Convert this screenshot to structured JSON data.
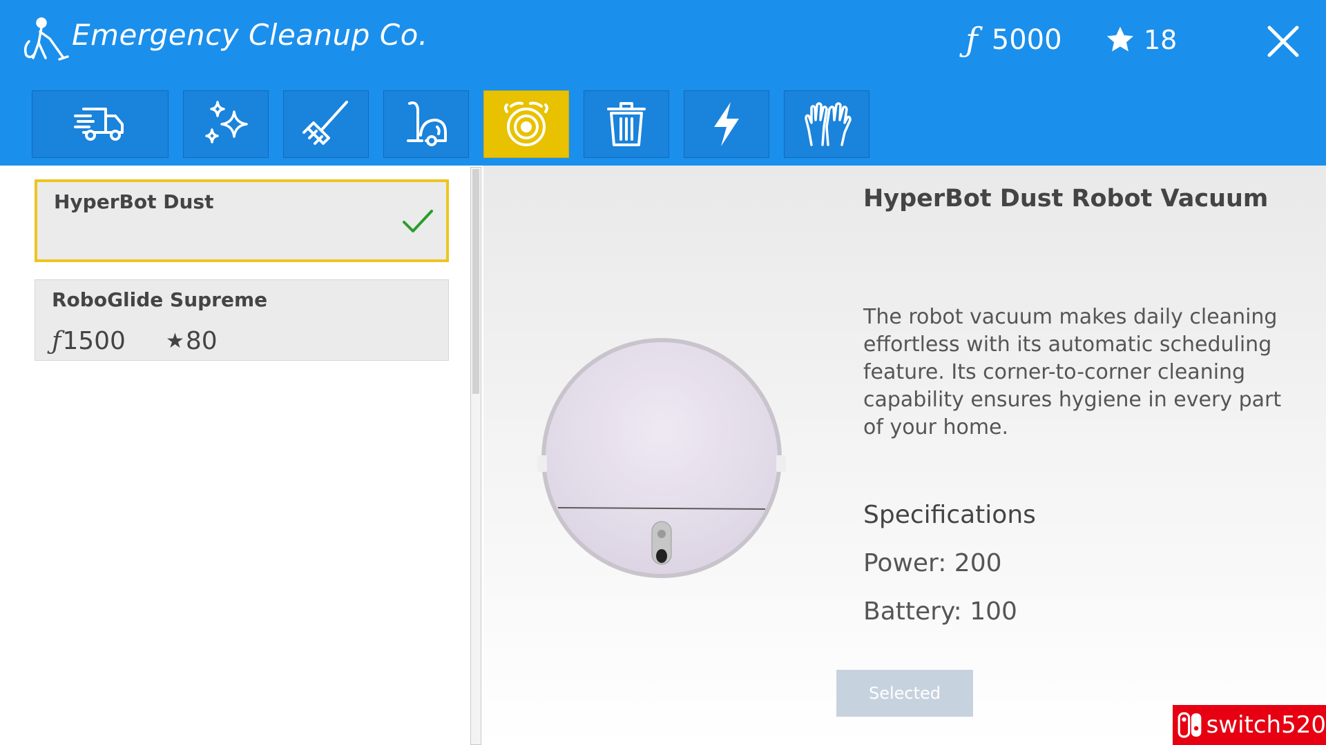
{
  "header": {
    "title": "Emergency Cleanup Co.",
    "logo_icon": "janitor-vacuum-icon",
    "currency_symbol": "ƒ",
    "money": "5000",
    "stars": "18",
    "close_icon": "close-icon"
  },
  "tabs": [
    {
      "icon": "cleaning-van-icon",
      "active": false
    },
    {
      "icon": "sparkles-icon",
      "active": false
    },
    {
      "icon": "mop-icon",
      "active": false
    },
    {
      "icon": "vacuum-cleaner-icon",
      "active": false
    },
    {
      "icon": "robot-vacuum-icon",
      "active": true
    },
    {
      "icon": "trash-can-icon",
      "active": false
    },
    {
      "icon": "lightning-icon",
      "active": false
    },
    {
      "icon": "gloves-icon",
      "active": false
    }
  ],
  "items": [
    {
      "name": "HyperBot Dust",
      "selected": true
    },
    {
      "name": "RoboGlide Supreme",
      "currency_symbol": "ƒ",
      "price": "1500",
      "star_symbol": "★",
      "stars": "80",
      "selected": false
    }
  ],
  "detail": {
    "title": "HyperBot Dust Robot Vacuum",
    "description": "The robot vacuum makes daily cleaning effortless with its automatic scheduling feature. Its corner-to-corner cleaning capability ensures hygiene in every part of your home.",
    "spec_title": "Specifications",
    "power": "Power: 200",
    "battery": "Battery: 100",
    "button": "Selected"
  },
  "watermark": "switch520",
  "colors": {
    "header": "#1b8fec",
    "tab": "#1a83dc",
    "tab_active": "#e8c100",
    "selected_border": "#ecc51f",
    "check": "#2a9d2a"
  }
}
